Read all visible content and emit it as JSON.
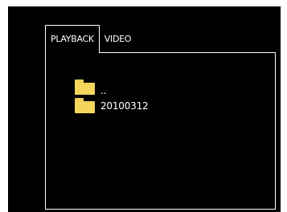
{
  "tabs": {
    "playback": "PLAYBACK",
    "video": "VIDEO"
  },
  "file_list": [
    {
      "icon": "folder-icon",
      "label": ".."
    },
    {
      "icon": "folder-icon",
      "label": "20100312"
    }
  ],
  "colors": {
    "background": "#000000",
    "frame": "#ffffff",
    "folder": "#f5d65c"
  }
}
